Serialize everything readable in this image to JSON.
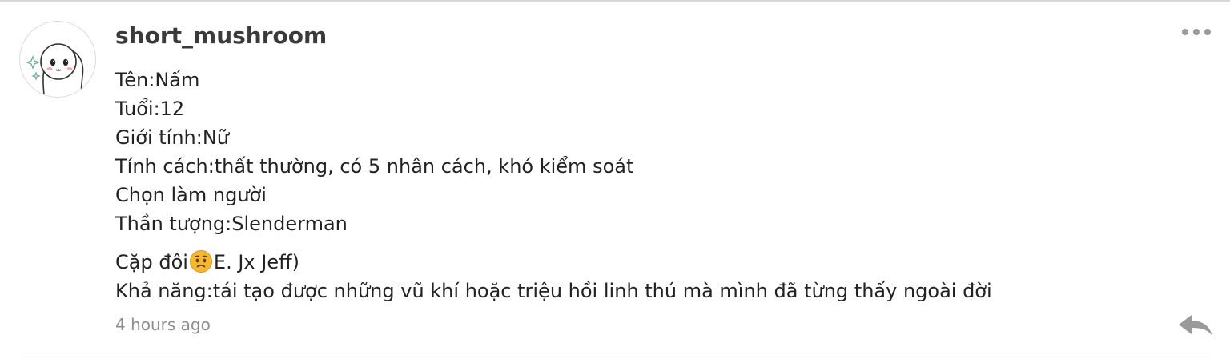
{
  "comment": {
    "username": "short_mushroom",
    "avatar_icon": "ghost-avatar-icon",
    "lines": [
      "Tên:Nấm",
      "Tuổi:12",
      "Giới tính:Nữ",
      "Tính cách:thất thường, có 5 nhân cách, khó kiểm soát",
      "Chọn làm người",
      "Thần tượng:Slenderman"
    ],
    "pair_prefix": "Cặp đôi",
    "pair_emoji": "worried-face-emoji",
    "pair_suffix": "E. Jx Jeff)",
    "ability": "Khả năng:tái tạo được những vũ khí hoặc triệu hồi linh thú mà mình đã từng thấy ngoài đời",
    "timestamp": "4 hours ago",
    "more_icon": "more-options-icon",
    "reply_icon": "reply-arrow-icon"
  },
  "colors": {
    "username": "#3a3a3a",
    "text": "#222222",
    "timestamp": "#8c8c8c",
    "icon": "#9a9a9a",
    "emoji": "#f5b82e"
  }
}
